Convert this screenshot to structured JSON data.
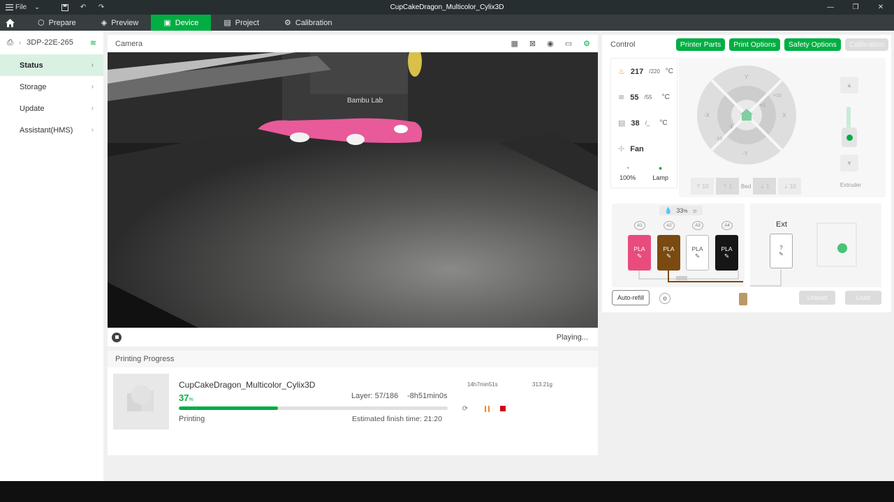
{
  "titlebar": {
    "file_label": "File",
    "window_title": "CupCakeDragon_Multicolor_Cylix3D"
  },
  "tabs": [
    {
      "label": "Prepare",
      "icon": "cube-icon"
    },
    {
      "label": "Preview",
      "icon": "layers-icon"
    },
    {
      "label": "Device",
      "icon": "device-icon"
    },
    {
      "label": "Project",
      "icon": "project-icon"
    },
    {
      "label": "Calibration",
      "icon": "gear-icon"
    }
  ],
  "sidebar": {
    "device_name": "3DP-22E-265",
    "items": [
      {
        "label": "Status",
        "active": true
      },
      {
        "label": "Storage",
        "active": false
      },
      {
        "label": "Update",
        "active": false
      },
      {
        "label": "Assistant(HMS)",
        "active": false
      }
    ]
  },
  "camera": {
    "title": "Camera",
    "status": "Playing...",
    "overlay_text": "Bambu Lab"
  },
  "progress": {
    "title": "Printing Progress",
    "job_name": "CupCakeDragon_Multicolor_Cylix3D",
    "percent_value": "37",
    "percent_unit": "%",
    "percent_fraction": 0.37,
    "layer": "Layer: 57/186",
    "remaining": "-8h51min0s",
    "state": "Printing",
    "finish": "Estimated finish time: 21:20",
    "print_time": "14h7min51s",
    "weight": "313.21g"
  },
  "control": {
    "title": "Control",
    "buttons": [
      "Printer Parts",
      "Print Options",
      "Safety Options",
      "Calibration"
    ],
    "nozzle": {
      "current": "217",
      "target": "/220",
      "unit": "°C"
    },
    "bed": {
      "current": "55",
      "target": "/55",
      "unit": "°C"
    },
    "chamber": {
      "current": "38",
      "target": "/_",
      "unit": "°C"
    },
    "fan_label": "Fan",
    "speed_value": "100%",
    "lamp_label": "Lamp",
    "jog": {
      "y_plus": "Y",
      "y_minus": "-Y",
      "x_plus": "X",
      "x_minus": "-X",
      "plus10": "+10",
      "minus10": "-10",
      "plus1": "+1",
      "minus1": "-1"
    },
    "bed_controls": [
      "10",
      "1",
      "Bed",
      "1",
      "10"
    ],
    "extruder_label": "Extruder"
  },
  "ams": {
    "humidity": "33",
    "humidity_unit": "%",
    "slots": [
      {
        "id": "A1",
        "material": "PLA",
        "color": "#e84c7d",
        "text_color": "#ffffff"
      },
      {
        "id": "A2",
        "material": "PLA",
        "color": "#7a4a10",
        "text_color": "#ffffff"
      },
      {
        "id": "A3",
        "material": "PLA",
        "color": "#ffffff",
        "text_color": "#555555"
      },
      {
        "id": "A4",
        "material": "PLA",
        "color": "#161616",
        "text_color": "#ffffff"
      }
    ],
    "ext_label": "Ext",
    "ext_material": "?",
    "auto_refill": "Auto-refill",
    "unload": "Unload",
    "load": "Load"
  },
  "colors": {
    "accent": "#00ae42",
    "titlebar": "#262e30",
    "tabbar": "#363e40"
  }
}
